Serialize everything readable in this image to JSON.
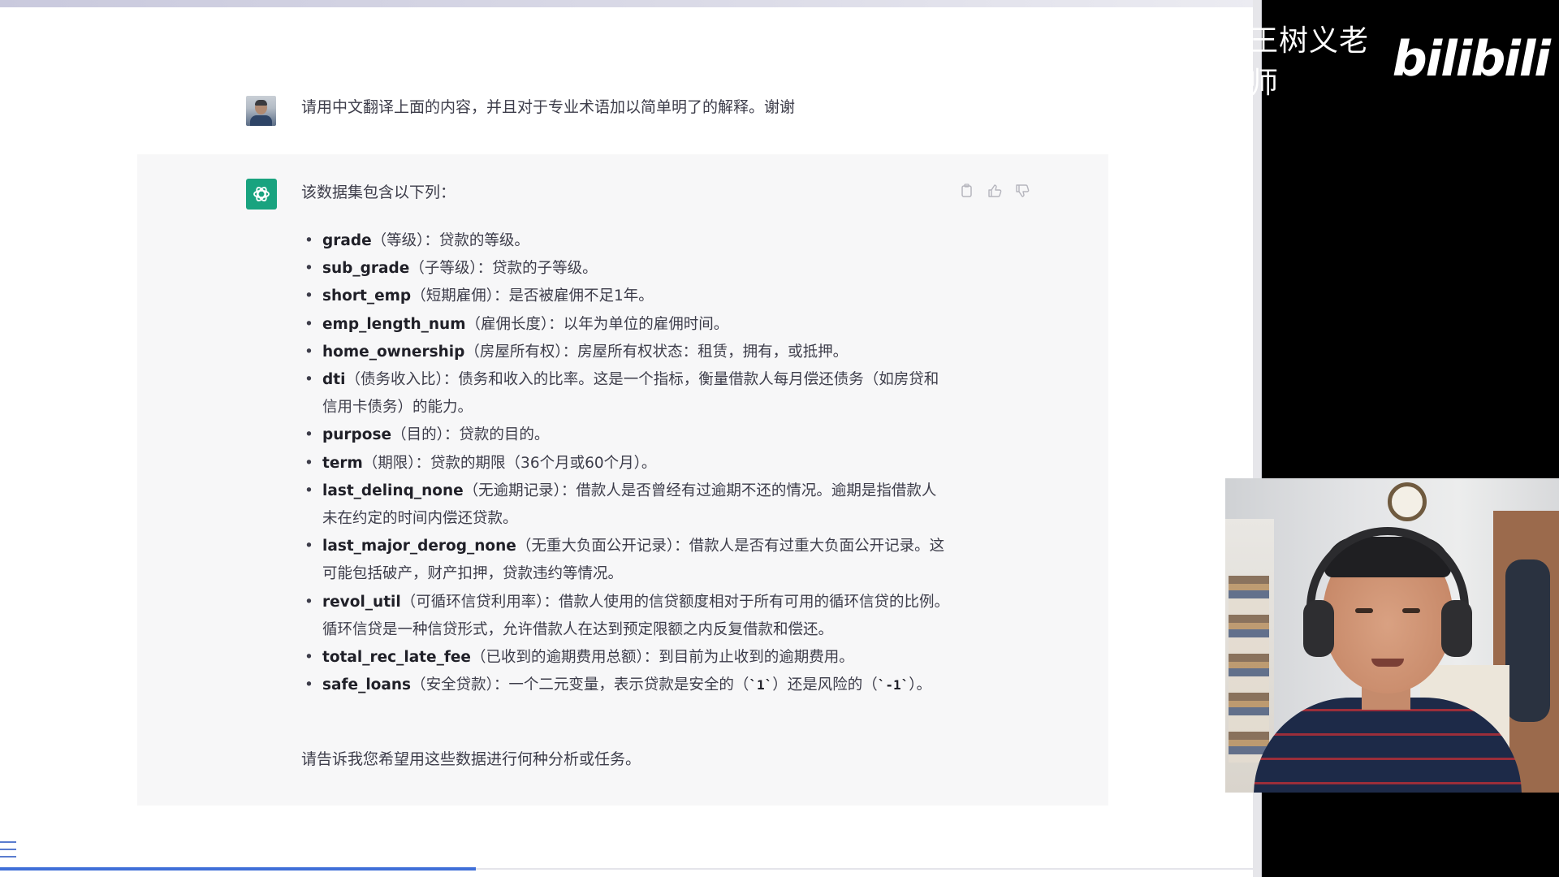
{
  "user_message": {
    "text": "请用中文翻译上面的内容，并且对于专业术语加以简单明了的解释。谢谢"
  },
  "assistant_message": {
    "intro": "该数据集包含以下列：",
    "items": [
      {
        "term": "grade",
        "desc": "（等级）：贷款的等级。"
      },
      {
        "term": "sub_grade",
        "desc": "（子等级）：贷款的子等级。"
      },
      {
        "term": "short_emp",
        "desc": "（短期雇佣）：是否被雇佣不足1年。"
      },
      {
        "term": "emp_length_num",
        "desc": "（雇佣长度）：以年为单位的雇佣时间。"
      },
      {
        "term": "home_ownership",
        "desc": "（房屋所有权）：房屋所有权状态：租赁，拥有，或抵押。"
      },
      {
        "term": "dti",
        "desc": "（债务收入比）：债务和收入的比率。这是一个指标，衡量借款人每月偿还债务（如房贷和信用卡债务）的能力。"
      },
      {
        "term": "purpose",
        "desc": "（目的）：贷款的目的。"
      },
      {
        "term": "term",
        "desc": "（期限）：贷款的期限（36个月或60个月）。"
      },
      {
        "term": "last_delinq_none",
        "desc": "（无逾期记录）：借款人是否曾经有过逾期不还的情况。逾期是指借款人未在约定的时间内偿还贷款。"
      },
      {
        "term": "last_major_derog_none",
        "desc": "（无重大负面公开记录）：借款人是否有过重大负面公开记录。这可能包括破产，财产扣押，贷款违约等情况。"
      },
      {
        "term": "revol_util",
        "desc": "（可循环信贷利用率）：借款人使用的信贷额度相对于所有可用的循环信贷的比例。循环信贷是一种信贷形式，允许借款人在达到预定限额之内反复借款和偿还。"
      },
      {
        "term": "total_rec_late_fee",
        "desc": "（已收到的逾期费用总额）：到目前为止收到的逾期费用。"
      }
    ],
    "last_item": {
      "term": "safe_loans",
      "desc_a": "（安全贷款）：一个二元变量，表示贷款是安全的（",
      "code_a": "`1`",
      "desc_b": "）还是风险的（",
      "code_b": "`-1`",
      "desc_c": "）。"
    },
    "outro": "请告诉我您希望用这些数据进行何种分析或任务。",
    "actions": [
      "copy-icon",
      "thumbs-up-icon",
      "thumbs-down-icon"
    ]
  },
  "watermark": {
    "creator": "王树义老师",
    "platform": "bilibili"
  },
  "scroll_progress": 0.38,
  "colors": {
    "gpt_avatar": "#19a37f",
    "panel_bg": "#f7f7f8",
    "text": "#3d3d4a",
    "progress": "#3f6fd8"
  }
}
